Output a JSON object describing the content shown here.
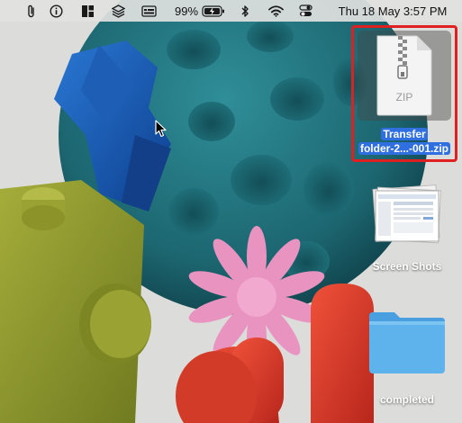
{
  "menubar": {
    "battery_percent": "99%",
    "datetime": "Thu 18 May  3:57 PM",
    "icons": [
      "paperclip-icon",
      "info-circle-icon",
      "window-layout-icon",
      "layers-icon",
      "keyboard-card-icon",
      "battery-charging-icon",
      "bluetooth-icon",
      "wifi-icon",
      "control-center-icon"
    ]
  },
  "desktop": {
    "items": [
      {
        "name": "Transfer folder-2...-001.zip",
        "label_line1": "Transfer",
        "label_line2": "folder-2...-001.zip",
        "badge": "ZIP",
        "selected": true
      },
      {
        "name": "Screen Shots",
        "label": "Screen Shots",
        "selected": false
      },
      {
        "name": "completed",
        "label": "completed",
        "selected": false
      }
    ]
  },
  "colors": {
    "selection_outline": "#e02020",
    "label_highlight": "#2f6fe0",
    "folder": "#5fb3ec"
  }
}
